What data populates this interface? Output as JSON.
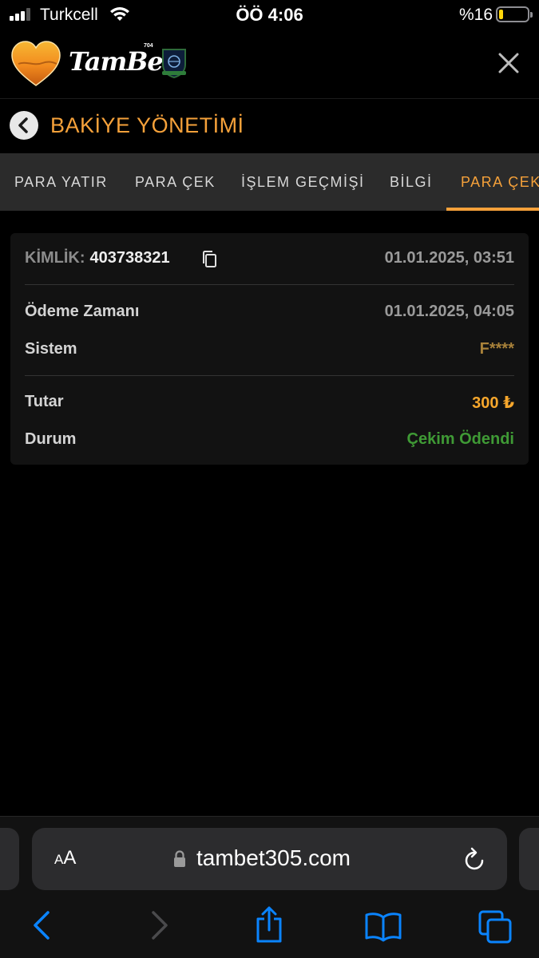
{
  "status_bar": {
    "carrier": "Turkcell",
    "time": "ÖÖ 4:06",
    "battery_percent": "%16",
    "battery_level": 0.16,
    "battery_color": "#ffd60a"
  },
  "header": {
    "logo_text": "TamBet",
    "logo_badge": "704"
  },
  "page": {
    "title": "BAKİYE YÖNETİMİ"
  },
  "tabs": [
    {
      "label": "PARA YATIR",
      "active": false
    },
    {
      "label": "PARA ÇEK",
      "active": false
    },
    {
      "label": "İŞLEM GEÇMİŞİ",
      "active": false
    },
    {
      "label": "BİLGİ",
      "active": false
    },
    {
      "label": "PARA ÇEK",
      "active": true
    }
  ],
  "transaction": {
    "id_label": "KİMLİK:",
    "id_value": "403738321",
    "created": "01.01.2025, 03:51",
    "rows": [
      {
        "label": "Ödeme Zamanı",
        "value": "01.01.2025, 04:05",
        "color": "#9a9a9a"
      },
      {
        "label": "Sistem",
        "value": "F****",
        "color": "#a9823a"
      },
      {
        "label": "Tutar",
        "value": "300 ₺",
        "color": "#f7a72c"
      },
      {
        "label": "Durum",
        "value": "Çekim Ödendi",
        "color": "#3f9a35"
      }
    ]
  },
  "safari": {
    "aa_small": "A",
    "aa_large": "A",
    "url": "tambet305.com"
  },
  "colors": {
    "accent": "#f5a13a",
    "ios_blue": "#0a84ff"
  }
}
